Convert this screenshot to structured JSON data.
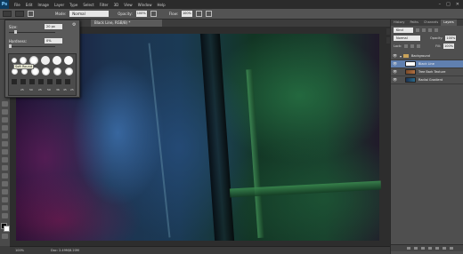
{
  "app": {
    "logo": "Ps"
  },
  "menu": [
    "File",
    "Edit",
    "Image",
    "Layer",
    "Type",
    "Select",
    "Filter",
    "3D",
    "View",
    "Window",
    "Help"
  ],
  "window_controls": [
    "–",
    "□",
    "✕"
  ],
  "options": {
    "mode_label": "Mode:",
    "mode_value": "Normal",
    "opacity_label": "Opacity:",
    "opacity_value": "100%",
    "flow_label": "Flow:",
    "flow_value": "100%"
  },
  "document": {
    "tab_title": "Black Line, RGB/8) *"
  },
  "brush_popup": {
    "size_label": "Size:",
    "size_value": "20 px",
    "hardness_label": "Hardness:",
    "hardness_value": "0%",
    "hover_tooltip": "Soft Round",
    "preset_numbers": [
      "25",
      "50",
      "25",
      "50",
      "36",
      "45",
      "25"
    ]
  },
  "panel": {
    "tabs": [
      "History",
      "Paths",
      "Channels",
      "Layers"
    ],
    "active_tab": "Layers",
    "kind_label": "Kind",
    "blend_mode": "Normal",
    "opacity_label": "Opacity:",
    "opacity_value": "100%",
    "lock_label": "Lock:",
    "fill_label": "Fill:",
    "fill_value": "100%",
    "group_name": "Background",
    "layers": [
      {
        "name": "Black Line"
      },
      {
        "name": "Tree Bark Texture"
      },
      {
        "name": "Radial Gradient"
      }
    ]
  },
  "status": {
    "zoom": "100%",
    "doc_info": "Doc: 2.49M/8.20M"
  },
  "colors": {
    "foreground": "#000000",
    "background": "#ffffff",
    "accent": "#6080b0"
  }
}
